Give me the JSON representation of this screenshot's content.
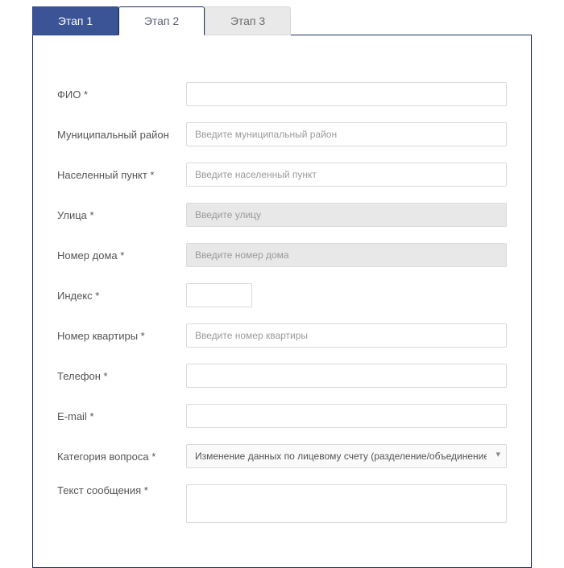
{
  "tabs": {
    "tab1": "Этап 1",
    "tab2": "Этап 2",
    "tab3": "Этап 3"
  },
  "form": {
    "fio": {
      "label": "ФИО *",
      "placeholder": ""
    },
    "district": {
      "label": "Муниципальный район",
      "placeholder": "Введите муниципальный район"
    },
    "settlement": {
      "label": "Населенный пункт *",
      "placeholder": "Введите населенный пункт"
    },
    "street": {
      "label": "Улица *",
      "placeholder": "Введите улицу"
    },
    "house": {
      "label": "Номер дома *",
      "placeholder": "Введите номер дома"
    },
    "index": {
      "label": "Индекс *",
      "placeholder": ""
    },
    "flat": {
      "label": "Номер квартиры *",
      "placeholder": "Введите номер квартиры"
    },
    "phone": {
      "label": "Телефон *",
      "placeholder": ""
    },
    "email": {
      "label": "E-mail *",
      "placeholder": ""
    },
    "category": {
      "label": "Категория вопроса *",
      "selected": "Изменение данных по лицевому счету (разделение/объединение лице..."
    },
    "message": {
      "label": "Текст сообщения *",
      "placeholder": ""
    }
  }
}
